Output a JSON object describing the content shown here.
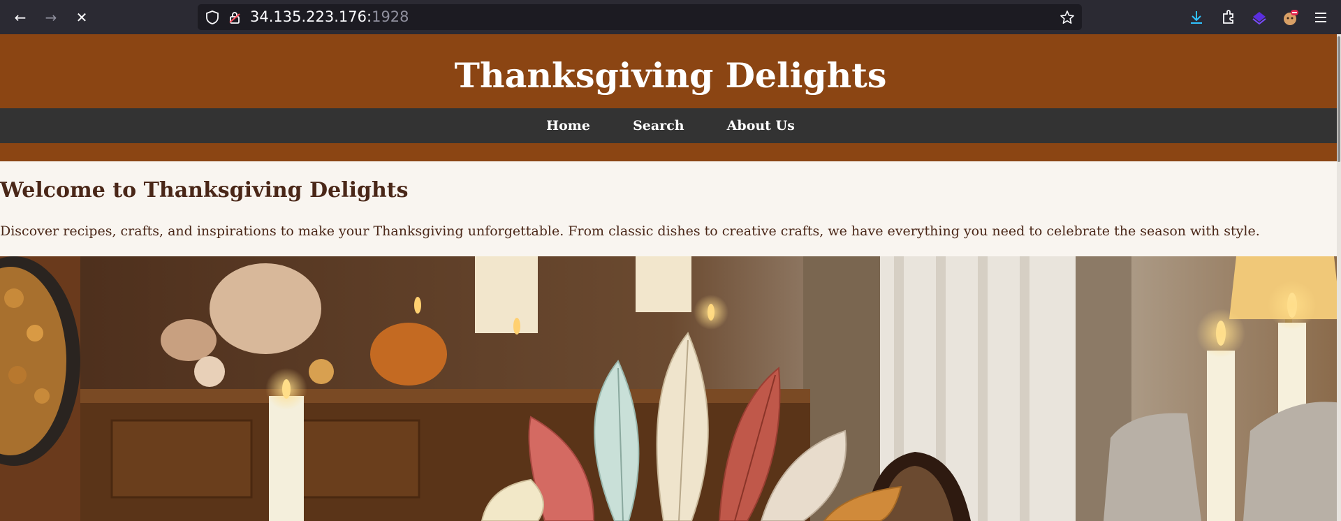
{
  "browser": {
    "url_host": "34.135.223.176:",
    "url_port": "1928",
    "icons": [
      "back-arrow-icon",
      "forward-arrow-icon",
      "stop-loading-icon",
      "shield-icon",
      "lock-icon",
      "star-icon",
      "download-icon",
      "extensions-icon",
      "vpn-icon",
      "profile-icon",
      "menu-icon"
    ]
  },
  "site": {
    "title": "Thanksgiving Delights",
    "nav": {
      "home": "Home",
      "search": "Search",
      "about": "About Us"
    },
    "welcome": {
      "heading": "Welcome to Thanksgiving Delights",
      "text": "Discover recipes, crafts, and inspirations to make your Thanksgiving unforgettable. From classic dishes to creative crafts, we have everything you need to celebrate the season with style."
    }
  },
  "colors": {
    "header_brown": "#8b4513",
    "nav_dark": "#333333",
    "page_bg": "#f9f5f0",
    "text_brown": "#4a2718"
  }
}
